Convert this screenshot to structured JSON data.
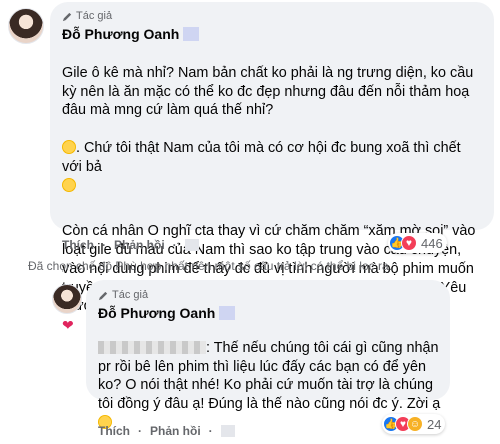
{
  "comment1": {
    "badge": "Tác giả",
    "author": "Đỗ Phương Oanh",
    "text": "Gile ô kê mà nhỉ? Nam bản chất ko phải là ng trưng diện, ko cầu kỳ nên là ăn mặc có thể ko đc đẹp nhưng đâu đến nỗi thảm hoạ đâu mà mng cứ làm quá thế nhỉ?",
    "text2": ". Chứ tôi thật Nam của tôi mà có cơ hội đc bung xoã thì chết với bả",
    "text3": "Còn cá nhân O nghĩ cta thay vì cứ chăm chăm “xăm mờ soi” vào loạt gile đủ màu của Nam thì sao ko tập trung vào câu chuyện, vào nội dung phim để thấy đc đủ vị tình người mà bộ phim muốn truyền tải, đúng với ý nghĩa “Hương vị tình thân” của nó ạ? Yêu thương",
    "like": "Thích",
    "reply": "Phản hồi",
    "reaction_count": "446",
    "reaction_icons": [
      "like-icon",
      "love-icon"
    ]
  },
  "notice": "Đã chọn chế độ Phù hợp nhất nên một số câu trả lời có thể bị lọc ra.",
  "comment2": {
    "badge": "Tác giả",
    "author": "Đỗ Phương Oanh",
    "text": ": Thế nếu chúng tôi cái gì cũng nhận pr rồi bê lên phim thì liệu lúc đấy các bạn có để yên ko? O nói thật nhé! Ko phải cứ muốn tài trợ là chúng tôi đồng ý đâu ạ! Đúng là thế nào cũng nói đc ý. Zời ạ",
    "like": "Thích",
    "reply": "Phản hồi",
    "reaction_count": "24",
    "reaction_icons": [
      "like-icon",
      "love-icon",
      "haha-icon"
    ]
  },
  "colors": {
    "bubble": "#f0f2f5",
    "like": "#1877f2",
    "love": "#f33e58",
    "secondary_text": "#65676b"
  }
}
